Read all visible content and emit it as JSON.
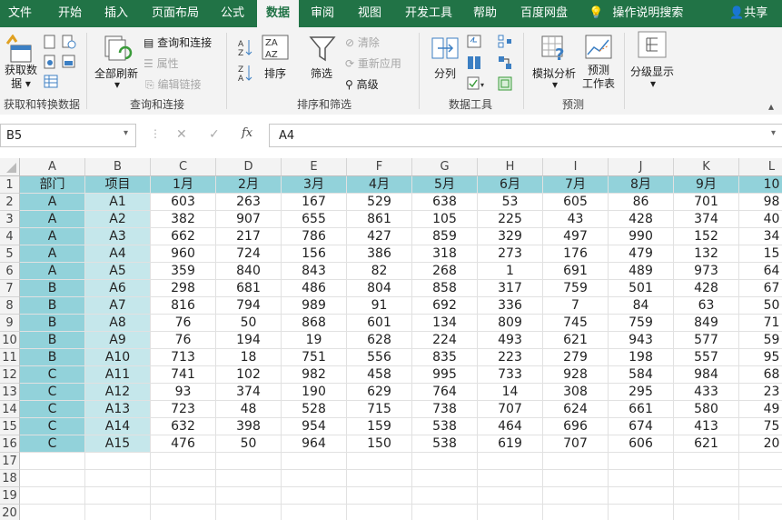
{
  "ribbon_tabs": [
    "文件",
    "开始",
    "插入",
    "页面布局",
    "公式",
    "数据",
    "审阅",
    "视图",
    "开发工具",
    "帮助",
    "百度网盘"
  ],
  "active_tab": "数据",
  "tell_me": "操作说明搜索",
  "share": "共享",
  "groups": {
    "get_data": {
      "label": "获取和转换数据",
      "get_data_btn_line1": "获取数",
      "get_data_btn_line2": "据"
    },
    "queries": {
      "label": "查询和连接",
      "refresh_all": "全部刷新",
      "queries_connections": "查询和连接",
      "properties": "属性",
      "edit_links": "编辑链接"
    },
    "sort_filter": {
      "label": "排序和筛选",
      "sort": "排序",
      "filter": "筛选",
      "clear": "清除",
      "reapply": "重新应用",
      "advanced": "高级"
    },
    "data_tools": {
      "label": "数据工具",
      "text_to_columns": "分列"
    },
    "forecast": {
      "label": "预测",
      "what_if": "模拟分析",
      "forecast_sheet_line1": "预测",
      "forecast_sheet_line2": "工作表"
    },
    "outline": {
      "label": "分级显示"
    }
  },
  "name_box": "B5",
  "formula_value": "A4",
  "fx_symbol": "fx",
  "columns": [
    "A",
    "B",
    "C",
    "D",
    "E",
    "F",
    "G",
    "H",
    "I",
    "J",
    "K",
    "L"
  ],
  "row_numbers": [
    "1",
    "2",
    "3",
    "4",
    "5",
    "6",
    "7",
    "8",
    "9",
    "10",
    "11",
    "12",
    "13",
    "14",
    "15",
    "16",
    "17",
    "18",
    "19",
    "20"
  ],
  "header_row": [
    "部门",
    "项目",
    "1月",
    "2月",
    "3月",
    "4月",
    "5月",
    "6月",
    "7月",
    "8月",
    "9月",
    "10"
  ],
  "rows": [
    [
      "A",
      "A1",
      "603",
      "263",
      "167",
      "529",
      "638",
      "53",
      "605",
      "86",
      "701",
      "98"
    ],
    [
      "A",
      "A2",
      "382",
      "907",
      "655",
      "861",
      "105",
      "225",
      "43",
      "428",
      "374",
      "40"
    ],
    [
      "A",
      "A3",
      "662",
      "217",
      "786",
      "427",
      "859",
      "329",
      "497",
      "990",
      "152",
      "34"
    ],
    [
      "A",
      "A4",
      "960",
      "724",
      "156",
      "386",
      "318",
      "273",
      "176",
      "479",
      "132",
      "15"
    ],
    [
      "A",
      "A5",
      "359",
      "840",
      "843",
      "82",
      "268",
      "1",
      "691",
      "489",
      "973",
      "64"
    ],
    [
      "B",
      "A6",
      "298",
      "681",
      "486",
      "804",
      "858",
      "317",
      "759",
      "501",
      "428",
      "67"
    ],
    [
      "B",
      "A7",
      "816",
      "794",
      "989",
      "91",
      "692",
      "336",
      "7",
      "84",
      "63",
      "50"
    ],
    [
      "B",
      "A8",
      "76",
      "50",
      "868",
      "601",
      "134",
      "809",
      "745",
      "759",
      "849",
      "71"
    ],
    [
      "B",
      "A9",
      "76",
      "194",
      "19",
      "628",
      "224",
      "493",
      "621",
      "943",
      "577",
      "59"
    ],
    [
      "B",
      "A10",
      "713",
      "18",
      "751",
      "556",
      "835",
      "223",
      "279",
      "198",
      "557",
      "95"
    ],
    [
      "C",
      "A11",
      "741",
      "102",
      "982",
      "458",
      "995",
      "733",
      "928",
      "584",
      "984",
      "68"
    ],
    [
      "C",
      "A12",
      "93",
      "374",
      "190",
      "629",
      "764",
      "14",
      "308",
      "295",
      "433",
      "23"
    ],
    [
      "C",
      "A13",
      "723",
      "48",
      "528",
      "715",
      "738",
      "707",
      "624",
      "661",
      "580",
      "49"
    ],
    [
      "C",
      "A14",
      "632",
      "398",
      "954",
      "159",
      "538",
      "464",
      "696",
      "674",
      "413",
      "75"
    ],
    [
      "C",
      "A15",
      "476",
      "50",
      "964",
      "150",
      "538",
      "619",
      "707",
      "606",
      "621",
      "20"
    ]
  ],
  "colors": {
    "excel_green": "#217346",
    "header_fill": "#92d2da",
    "project_fill": "#c5e7eb"
  }
}
